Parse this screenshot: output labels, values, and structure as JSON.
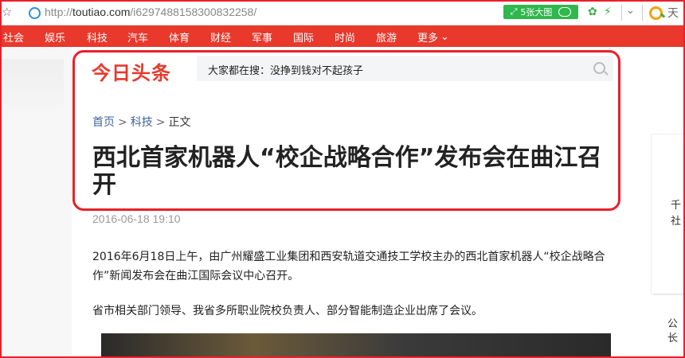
{
  "browser": {
    "url_prefix": "http://",
    "url_host": "toutiao.com",
    "url_path": "/i6297488158300832258/",
    "big_image_button": "5张大图"
  },
  "nav": {
    "items": [
      "社会",
      "娱乐",
      "科技",
      "汽车",
      "体育",
      "财经",
      "军事",
      "国际",
      "时尚",
      "旅游"
    ],
    "more": "更多"
  },
  "site": {
    "logo": "今日头条",
    "search_query": "大家都在搜：没挣到钱对不起孩子"
  },
  "breadcrumb": {
    "home": "首页",
    "category": "科技",
    "current": "正文",
    "separator": ">"
  },
  "article": {
    "title": "西北首家机器人“校企战略合作”发布会在曲江召开",
    "date": "2016-06-18 19:10",
    "paragraphs": [
      "2016年6月18日上午，由广州耀盛工业集团和西安轨道交通技工学校主办的西北首家机器人“校企战略合作”新闻发布会在曲江国际会议中心召开。",
      "省市相关部门领导、我省多所职业院校负责人、部分智能制造企业出席了会议。"
    ]
  },
  "right_panel": {
    "line1": "千",
    "line2": "社",
    "line3": "公",
    "line4": "长"
  },
  "toolbar": {
    "more_text": "天"
  },
  "colors": {
    "nav_red": "#e8392c",
    "highlight_red": "#e8202a",
    "link_blue": "#406599",
    "green_button": "#2fb84d"
  }
}
